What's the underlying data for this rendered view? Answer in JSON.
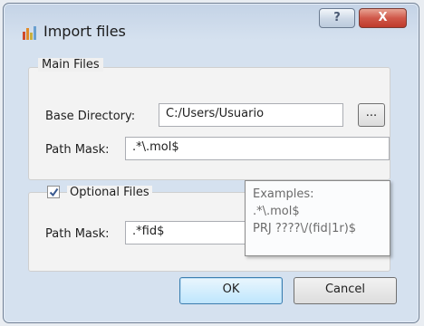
{
  "window": {
    "title": "Import files",
    "help_label": "?",
    "close_label": "X"
  },
  "main_files": {
    "group_title": "Main Files",
    "base_directory_label": "Base Directory:",
    "base_directory_value": "C:/Users/Usuario",
    "browse_label": "...",
    "path_mask_label": "Path Mask:",
    "path_mask_value": ".*\\.mol$"
  },
  "optional_files": {
    "checkbox_label": "Optional Files",
    "checked": true,
    "path_mask_label": "Path Mask:",
    "path_mask_value": ".*fid$"
  },
  "tooltip": {
    "lines": [
      "Examples:",
      ".*\\.mol$",
      "PRJ ????\\/(fid|1r)$"
    ]
  },
  "buttons": {
    "ok_label": "OK",
    "cancel_label": "Cancel"
  },
  "colors": {
    "title_bar": "#c4d3e6",
    "close_button": "#c7483a",
    "ok_button_border": "#3c7fb1"
  }
}
